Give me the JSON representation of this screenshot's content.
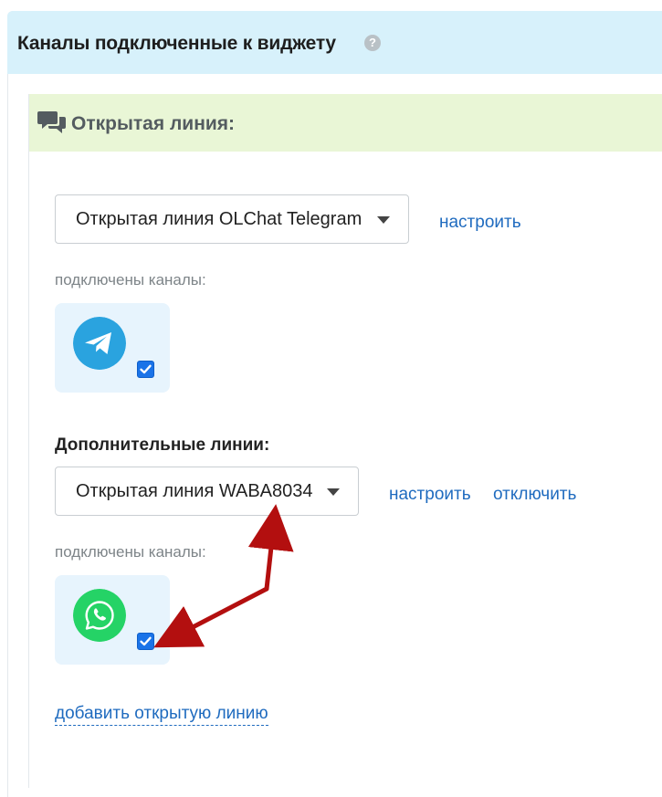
{
  "widget": {
    "title": "Каналы подключенные к виджету",
    "help_icon": "?"
  },
  "open_line": {
    "title": "Открытая линия:",
    "icon": "chat-bubbles-icon",
    "primary_select": {
      "value": "Открытая линия OLChat Telegram",
      "configure_label": "настроить"
    },
    "connected_label": "подключены каналы:",
    "primary_channels": [
      {
        "name": "telegram",
        "icon": "telegram-icon",
        "color": "#2aa3df",
        "checked": true
      }
    ],
    "additional_title": "Дополнительные линии:",
    "additional_select": {
      "value": "Открытая линия WABA8034",
      "configure_label": "настроить",
      "disable_label": "отключить"
    },
    "additional_connected_label": "подключены каналы:",
    "additional_channels": [
      {
        "name": "whatsapp",
        "icon": "whatsapp-icon",
        "color": "#25d366",
        "checked": true
      }
    ],
    "add_line_label": "добавить открытую линию"
  },
  "colors": {
    "header_bg": "#d7f1fb",
    "section_bg": "#e9f6d6",
    "link": "#1f6bbf",
    "annotation_arrow": "#b30f0f"
  }
}
